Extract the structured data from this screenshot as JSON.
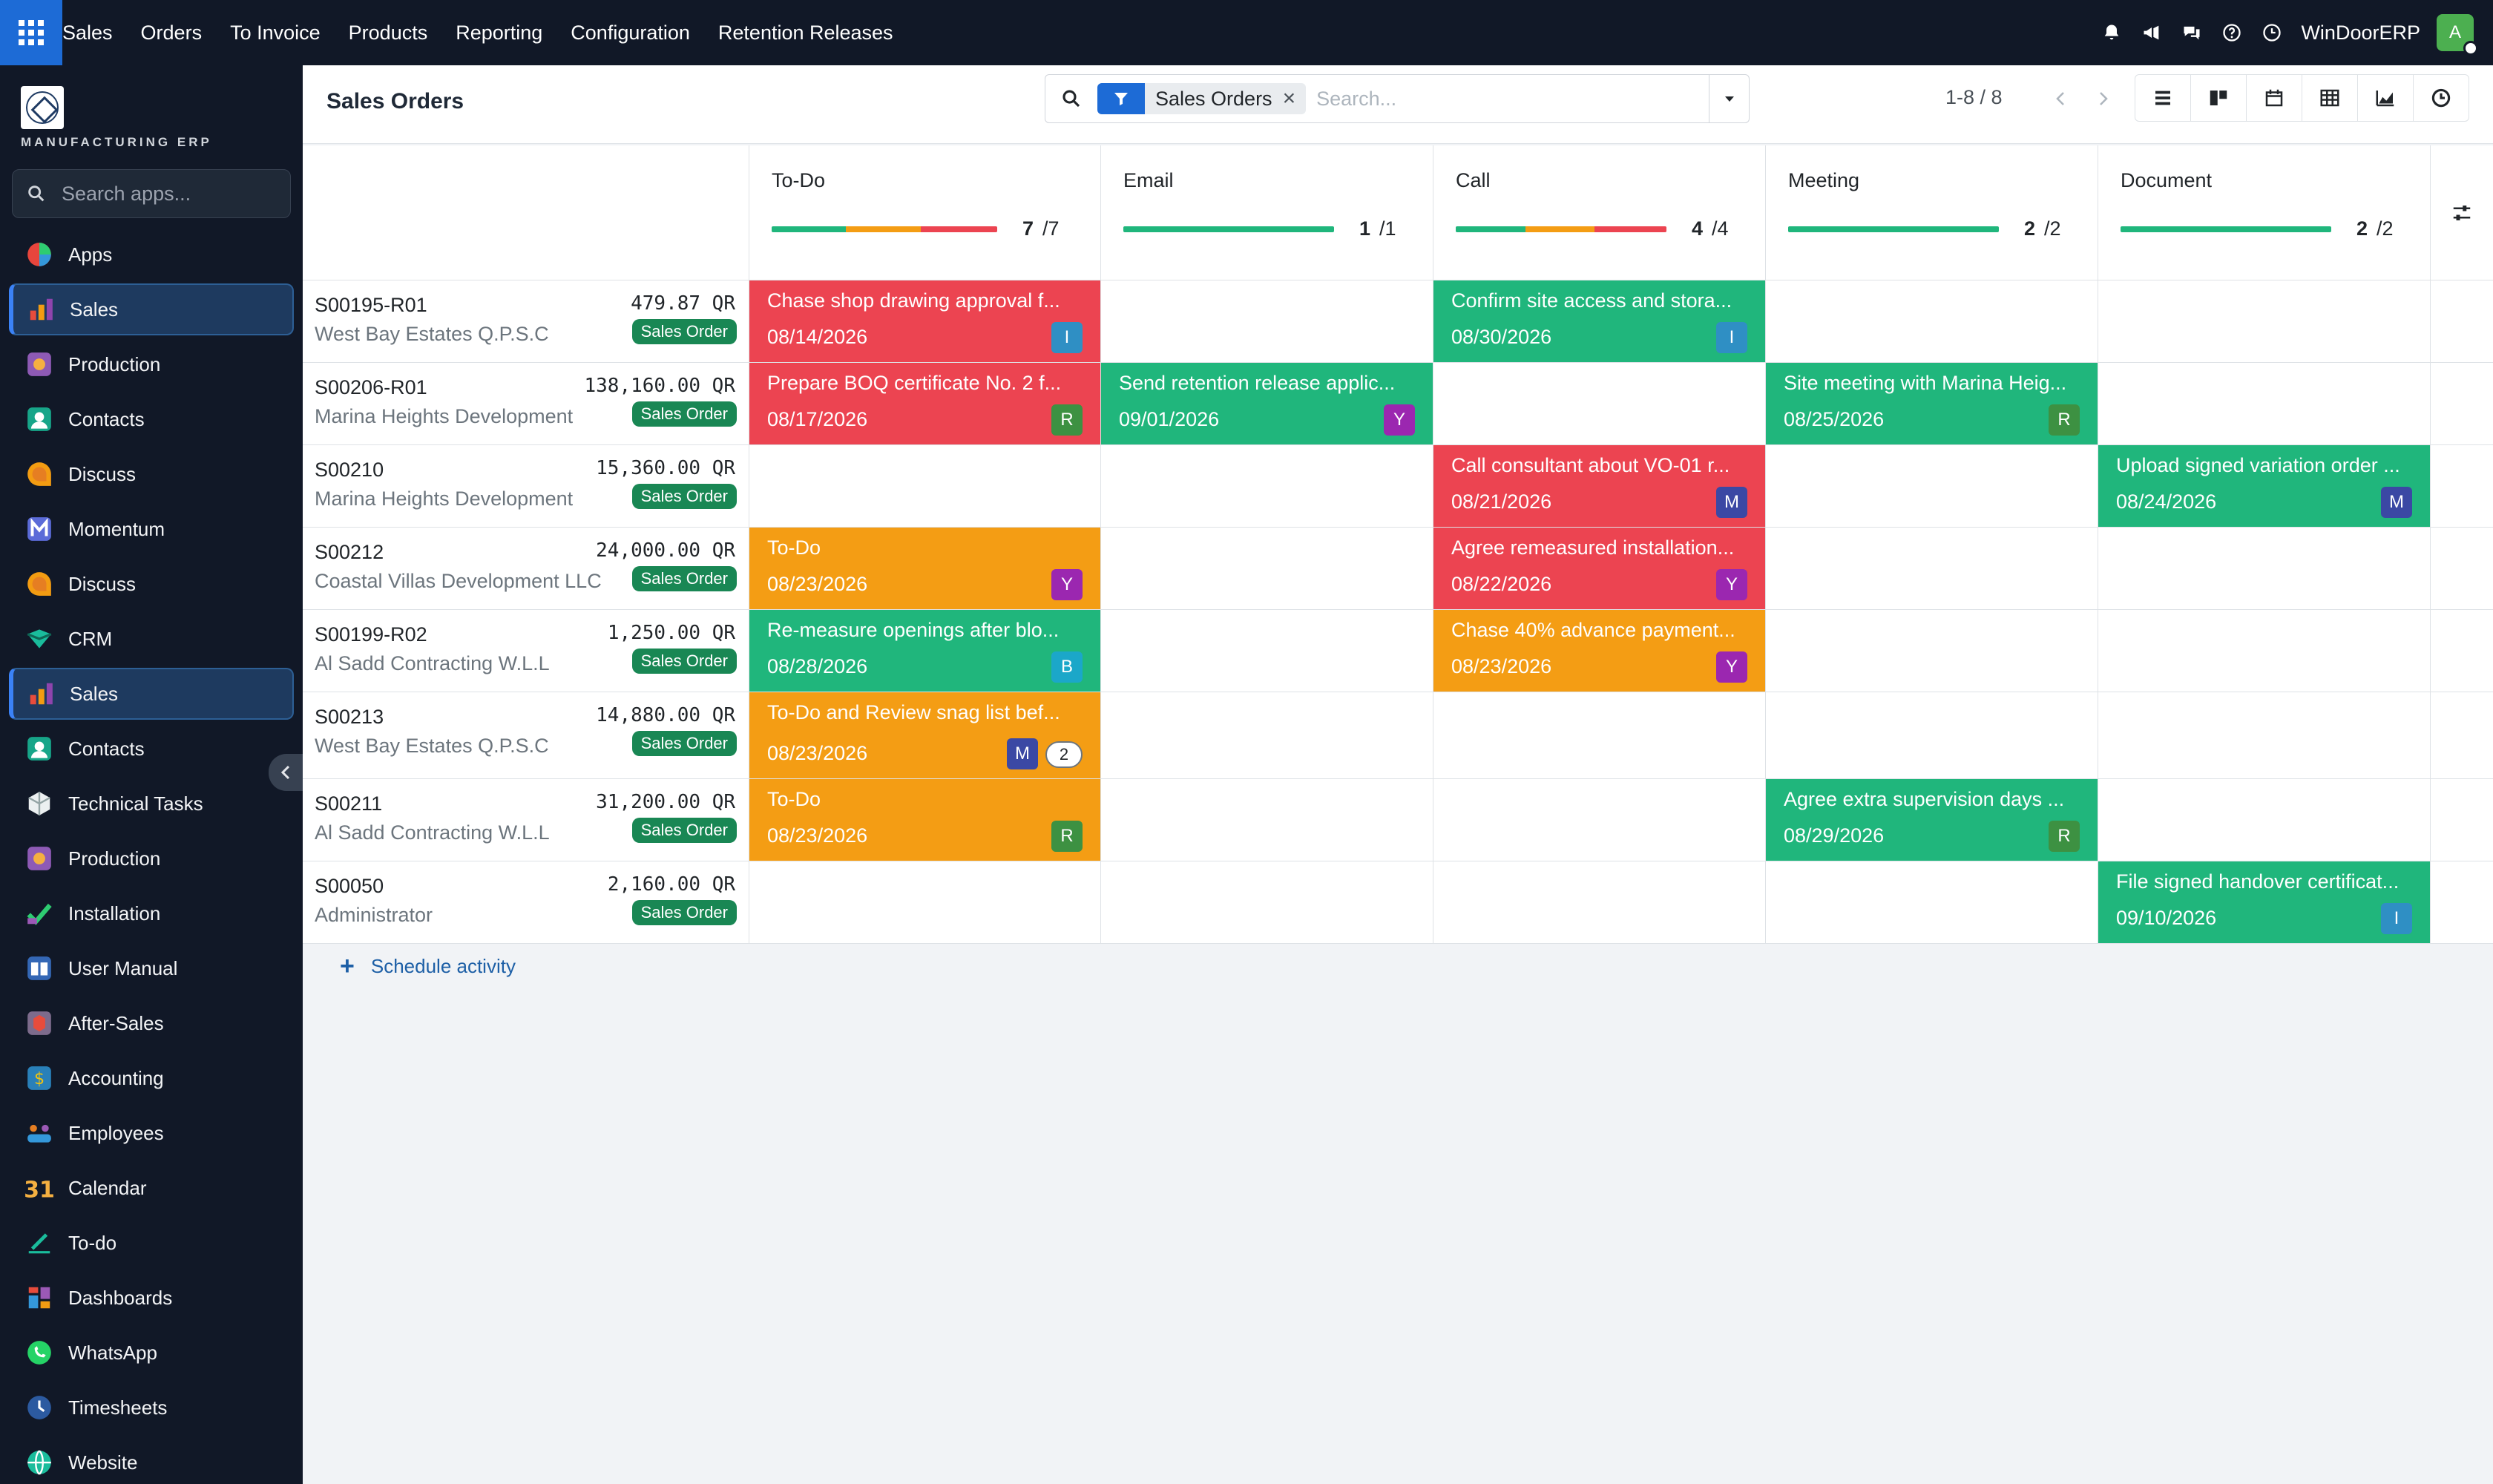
{
  "topbar": {
    "brand": "Sales",
    "menu": [
      "Orders",
      "To Invoice",
      "Products",
      "Reporting",
      "Configuration",
      "Retention Releases"
    ],
    "company": "WinDoorERP",
    "user_initial": "A"
  },
  "sidebar": {
    "brand_text": "MANUFACTURING ERP",
    "search_placeholder": "Search apps...",
    "items": [
      {
        "label": "Apps",
        "icon": "apps-pie-icon",
        "active": false
      },
      {
        "label": "Sales",
        "icon": "sales-chart-icon",
        "active": true
      },
      {
        "label": "Production",
        "icon": "production-icon",
        "active": false
      },
      {
        "label": "Contacts",
        "icon": "contacts-icon",
        "active": false
      },
      {
        "label": "Discuss",
        "icon": "discuss-icon",
        "active": false
      },
      {
        "label": "Momentum",
        "icon": "momentum-icon",
        "active": false
      },
      {
        "label": "Discuss",
        "icon": "discuss-icon",
        "active": false
      },
      {
        "label": "CRM",
        "icon": "crm-icon",
        "active": false
      },
      {
        "label": "Sales",
        "icon": "sales-chart-icon",
        "active": true
      },
      {
        "label": "Contacts",
        "icon": "contacts-icon",
        "active": false
      },
      {
        "label": "Technical Tasks",
        "icon": "technical-tasks-icon",
        "active": false
      },
      {
        "label": "Production",
        "icon": "production-icon",
        "active": false
      },
      {
        "label": "Installation",
        "icon": "installation-icon",
        "active": false
      },
      {
        "label": "User Manual",
        "icon": "user-manual-icon",
        "active": false
      },
      {
        "label": "After-Sales",
        "icon": "after-sales-icon",
        "active": false
      },
      {
        "label": "Accounting",
        "icon": "accounting-icon",
        "active": false
      },
      {
        "label": "Employees",
        "icon": "employees-icon",
        "active": false
      },
      {
        "label": "Calendar",
        "icon": "calendar-icon",
        "active": false
      },
      {
        "label": "To-do",
        "icon": "todo-icon",
        "active": false
      },
      {
        "label": "Dashboards",
        "icon": "dashboards-icon",
        "active": false
      },
      {
        "label": "WhatsApp",
        "icon": "whatsapp-icon",
        "active": false
      },
      {
        "label": "Timesheets",
        "icon": "timesheets-icon",
        "active": false
      },
      {
        "label": "Website",
        "icon": "website-icon",
        "active": false
      }
    ]
  },
  "control": {
    "title": "Sales Orders",
    "facet": "Sales Orders",
    "search_placeholder": "Search...",
    "pager": "1-8 / 8"
  },
  "columns": [
    {
      "title": "To-Do",
      "count": "7",
      "total": "/7",
      "segments": [
        {
          "color": "#20b67c",
          "frac": 0.33
        },
        {
          "color": "#f49d14",
          "frac": 0.33
        },
        {
          "color": "#ec4451",
          "frac": 0.34
        }
      ]
    },
    {
      "title": "Email",
      "count": "1",
      "total": "/1",
      "segments": [
        {
          "color": "#20b67c",
          "frac": 1.0
        }
      ]
    },
    {
      "title": "Call",
      "count": "4",
      "total": "/4",
      "segments": [
        {
          "color": "#20b67c",
          "frac": 0.33
        },
        {
          "color": "#f49d14",
          "frac": 0.33
        },
        {
          "color": "#ec4451",
          "frac": 0.34
        }
      ]
    },
    {
      "title": "Meeting",
      "count": "2",
      "total": "/2",
      "segments": [
        {
          "color": "#20b67c",
          "frac": 1.0
        }
      ]
    },
    {
      "title": "Document",
      "count": "2",
      "total": "/2",
      "segments": [
        {
          "color": "#20b67c",
          "frac": 1.0
        }
      ]
    }
  ],
  "rows": [
    {
      "name": "S00195-R01",
      "partner": "West Bay Estates Q.P.S.C",
      "amount": "479.87 QR",
      "badge": "Sales Order",
      "cells": [
        {
          "summary": "Chase shop drawing approval f...",
          "date": "08/14/2026",
          "state": "red",
          "user": "I"
        },
        null,
        {
          "summary": "Confirm site access and stora...",
          "date": "08/30/2026",
          "state": "green",
          "user": "I"
        },
        null,
        null
      ]
    },
    {
      "name": "S00206-R01",
      "partner": "Marina Heights Development",
      "amount": "138,160.00 QR",
      "badge": "Sales Order",
      "cells": [
        {
          "summary": "Prepare BOQ certificate No. 2 f...",
          "date": "08/17/2026",
          "state": "red",
          "user": "R"
        },
        {
          "summary": "Send retention release applic...",
          "date": "09/01/2026",
          "state": "green",
          "user": "Y"
        },
        null,
        {
          "summary": "Site meeting with Marina Heig...",
          "date": "08/25/2026",
          "state": "green",
          "user": "R"
        },
        null
      ]
    },
    {
      "name": "S00210",
      "partner": "Marina Heights Development",
      "amount": "15,360.00 QR",
      "badge": "Sales Order",
      "cells": [
        null,
        null,
        {
          "summary": "Call consultant about VO-01 r...",
          "date": "08/21/2026",
          "state": "red",
          "user": "M"
        },
        null,
        {
          "summary": "Upload signed variation order ...",
          "date": "08/24/2026",
          "state": "green",
          "user": "M"
        }
      ]
    },
    {
      "name": "S00212",
      "partner": "Coastal Villas Development LLC",
      "amount": "24,000.00 QR",
      "badge": "Sales Order",
      "cells": [
        {
          "summary": "To-Do",
          "date": "08/23/2026",
          "state": "orange",
          "user": "Y"
        },
        null,
        {
          "summary": "Agree remeasured installation...",
          "date": "08/22/2026",
          "state": "red",
          "user": "Y"
        },
        null,
        null
      ]
    },
    {
      "name": "S00199-R02",
      "partner": "Al Sadd Contracting W.L.L",
      "amount": "1,250.00 QR",
      "badge": "Sales Order",
      "cells": [
        {
          "summary": "Re-measure openings after blo...",
          "date": "08/28/2026",
          "state": "green",
          "user": "B"
        },
        null,
        {
          "summary": "Chase 40% advance payment...",
          "date": "08/23/2026",
          "state": "orange",
          "user": "Y"
        },
        null,
        null
      ]
    },
    {
      "name": "S00213",
      "partner": "West Bay Estates Q.P.S.C",
      "amount": "14,880.00 QR",
      "badge": "Sales Order",
      "cells": [
        {
          "summary": "To-Do and Review snag list bef...",
          "date": "08/23/2026",
          "state": "orange",
          "user": "M",
          "count": "2"
        },
        null,
        null,
        null,
        null
      ]
    },
    {
      "name": "S00211",
      "partner": "Al Sadd Contracting W.L.L",
      "amount": "31,200.00 QR",
      "badge": "Sales Order",
      "cells": [
        {
          "summary": "To-Do",
          "date": "08/23/2026",
          "state": "orange",
          "user": "R"
        },
        null,
        null,
        {
          "summary": "Agree extra supervision days ...",
          "date": "08/29/2026",
          "state": "green",
          "user": "R"
        },
        null
      ]
    },
    {
      "name": "S00050",
      "partner": "Administrator",
      "amount": "2,160.00 QR",
      "badge": "Sales Order",
      "cells": [
        null,
        null,
        null,
        null,
        {
          "summary": "File signed handover certificat...",
          "date": "09/10/2026",
          "state": "green",
          "user": "I"
        }
      ]
    }
  ],
  "footer": {
    "schedule_label": "Schedule activity",
    "schedule_icon": "plus-icon"
  }
}
